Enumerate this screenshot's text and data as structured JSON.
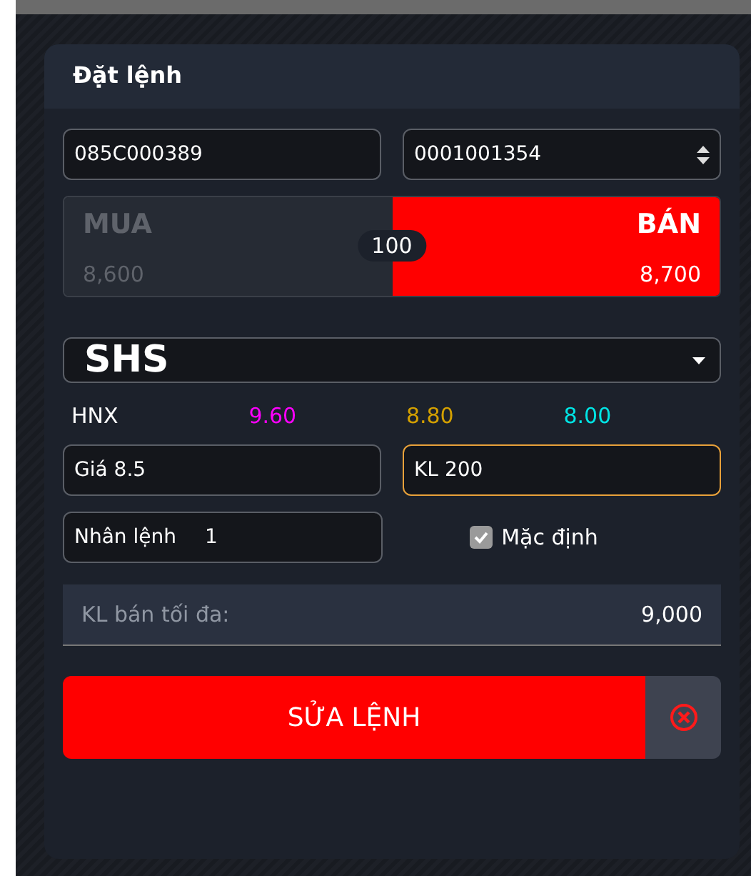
{
  "panel": {
    "title": "Đặt lệnh"
  },
  "account": {
    "value": "085C000389"
  },
  "sub_account": {
    "value": "0001001354"
  },
  "sides": [
    {
      "label": "MUA",
      "price": "8,600",
      "selected": false,
      "kind": "buy"
    },
    {
      "label": "BÁN",
      "price": "8,700",
      "selected": true,
      "kind": "sell"
    }
  ],
  "lot": "100",
  "symbol": {
    "value": "SHS"
  },
  "exchange": "HNX",
  "prices": [
    {
      "value": "9.60",
      "color": "#ff00ff"
    },
    {
      "value": "8.80",
      "color": "#d4a000"
    },
    {
      "value": "8.00",
      "color": "#00e5e5"
    }
  ],
  "price_field": {
    "label": "Giá",
    "value": "8.5",
    "focused": false
  },
  "volume_field": {
    "label": "KL",
    "value": "200",
    "focused": true
  },
  "multiplier_field": {
    "label": "Nhân lệnh",
    "value": "1"
  },
  "default_checkbox": {
    "label": "Mặc định",
    "checked": true
  },
  "max_sell": {
    "label": "KL bán tối đa:",
    "value": "9,000"
  },
  "submit": {
    "label": "SỬA LỆNH"
  }
}
